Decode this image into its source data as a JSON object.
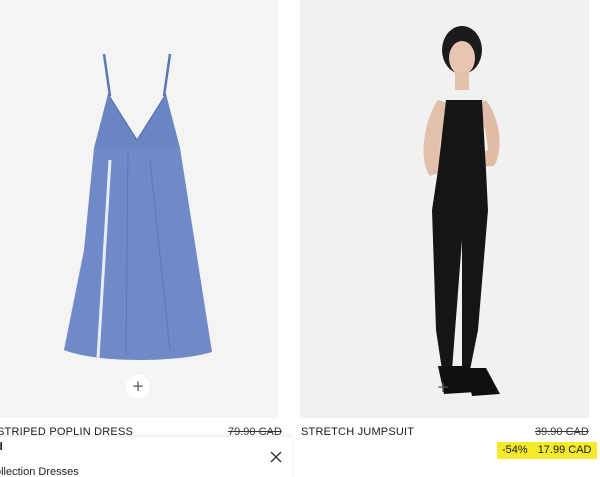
{
  "products": [
    {
      "name": "STRIPED POPLIN DRESS",
      "original_price": "79.90 CAD",
      "image_icon": "dress-photo",
      "add_icon": "+"
    },
    {
      "name": "STRETCH JUMPSUIT",
      "original_price": "39.90 CAD",
      "discount": "-54%",
      "sale_price": "17.99 CAD",
      "image_icon": "jumpsuit-photo",
      "add_icon": "+"
    }
  ],
  "popup": {
    "title": "d",
    "text": "ollection Dresses",
    "close_icon": "close-icon"
  },
  "colors": {
    "sale_tag": "#f4ea2a",
    "dress": "#6b88c4",
    "jumpsuit": "#141414"
  }
}
